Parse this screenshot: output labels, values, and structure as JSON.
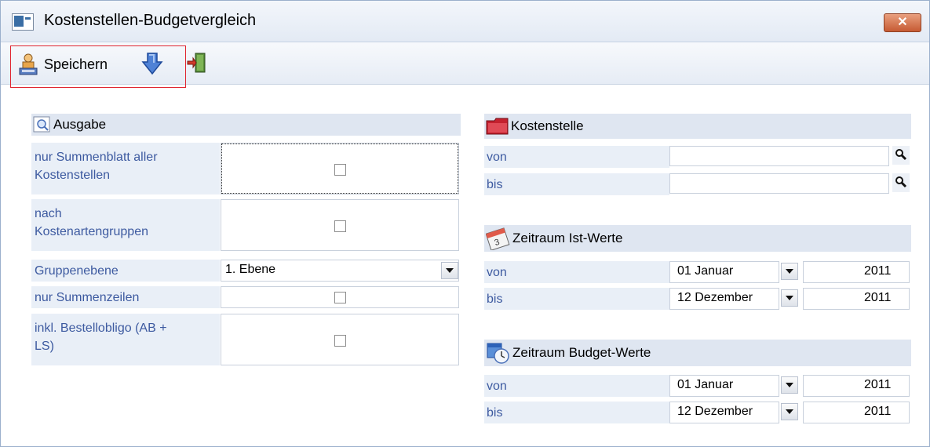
{
  "window": {
    "title": "Kostenstellen-Budgetvergleich",
    "close_label": "✕"
  },
  "toolbar": {
    "save_label": "Speichern"
  },
  "ausgabe": {
    "header": "Ausgabe",
    "rows": [
      {
        "label": "nur Summenblatt aller Kostenstellen",
        "checked": false
      },
      {
        "label": "nach Kostenartengruppen",
        "checked": false
      },
      {
        "label": "Gruppenebene",
        "value": "1. Ebene"
      },
      {
        "label": "nur Summenzeilen",
        "checked": false
      },
      {
        "label": "inkl. Bestellobligo (AB + LS)",
        "checked": false
      }
    ],
    "label_lines": {
      "r0a": "nur Summenblatt aller",
      "r0b": "Kostenstellen",
      "r1a": "nach",
      "r1b": "Kostenartengruppen",
      "r2": "Gruppenebene",
      "r3": "nur Summenzeilen",
      "r4a": "inkl. Bestellobligo (AB +",
      "r4b": "LS)"
    }
  },
  "kostenstelle": {
    "header": "Kostenstelle",
    "von_label": "von",
    "von_value": "",
    "bis_label": "bis",
    "bis_value": ""
  },
  "ist_werte": {
    "header": "Zeitraum Ist-Werte",
    "von_label": "von",
    "von_month": "01 Januar",
    "von_year": "2011",
    "bis_label": "bis",
    "bis_month": "12 Dezember",
    "bis_year": "2011"
  },
  "budget_werte": {
    "header": "Zeitraum Budget-Werte",
    "von_label": "von",
    "von_month": "01 Januar",
    "von_year": "2011",
    "bis_label": "bis",
    "bis_month": "12 Dezember",
    "bis_year": "2011"
  },
  "icons": {
    "window": "app-window-icon",
    "save": "save-icon",
    "arrow": "arrow-down-icon",
    "exit": "exit-door-icon",
    "ausgabe": "magnifier-page-icon",
    "kostenstelle": "folder-icon",
    "ist": "calendar-icon",
    "budget": "calendar-clock-icon",
    "search": "search-icon"
  },
  "colors": {
    "label_blue": "#3d5aa0",
    "header_bg": "#dfe6f1",
    "close_red": "#c65a33",
    "highlight_red": "#e0242f"
  }
}
